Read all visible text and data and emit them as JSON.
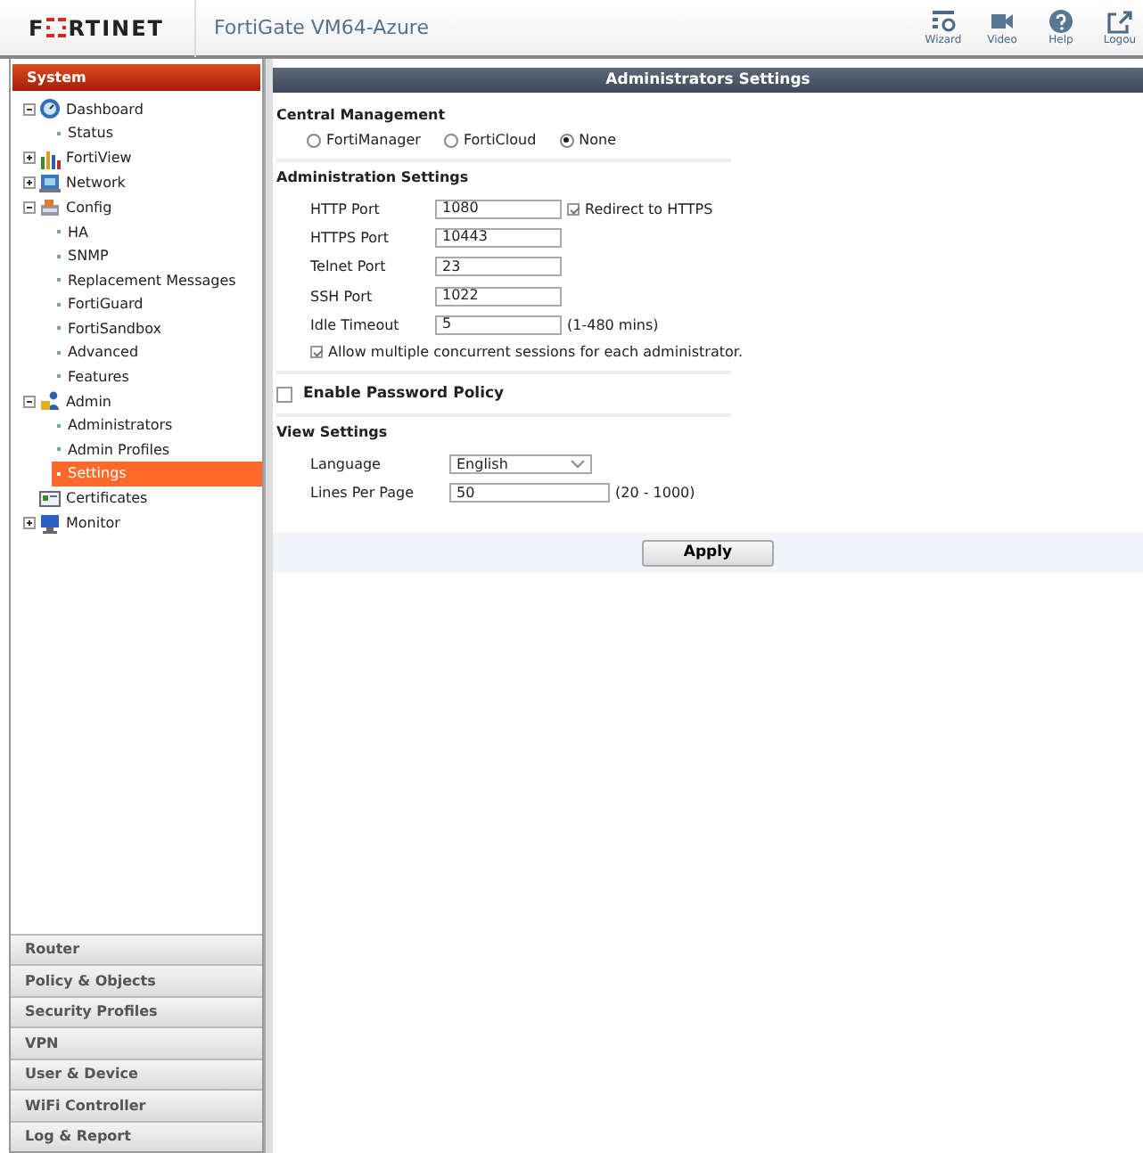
{
  "header": {
    "logo_left": "F",
    "logo_right": "RTINET",
    "product": "FortiGate VM64-Azure",
    "tools": [
      {
        "label": "Wizard"
      },
      {
        "label": "Video"
      },
      {
        "label": "Help"
      },
      {
        "label": "Logou"
      }
    ]
  },
  "sidebar": {
    "title": "System",
    "tree": [
      {
        "label": "Dashboard",
        "kind": "group",
        "expanded": true,
        "selected": false,
        "children": [
          {
            "label": "Status",
            "selected": false
          }
        ]
      },
      {
        "label": "FortiView",
        "kind": "group",
        "expanded": false,
        "selected": false
      },
      {
        "label": "Network",
        "kind": "group",
        "expanded": false,
        "selected": false
      },
      {
        "label": "Config",
        "kind": "group",
        "expanded": true,
        "selected": false,
        "children": [
          {
            "label": "HA",
            "selected": false
          },
          {
            "label": "SNMP",
            "selected": false
          },
          {
            "label": "Replacement Messages",
            "selected": false
          },
          {
            "label": "FortiGuard",
            "selected": false
          },
          {
            "label": "FortiSandbox",
            "selected": false
          },
          {
            "label": "Advanced",
            "selected": false
          },
          {
            "label": "Features",
            "selected": false
          }
        ]
      },
      {
        "label": "Admin",
        "kind": "group",
        "expanded": true,
        "selected": false,
        "children": [
          {
            "label": "Administrators",
            "selected": false
          },
          {
            "label": "Admin Profiles",
            "selected": false
          },
          {
            "label": "Settings",
            "selected": true
          }
        ]
      },
      {
        "label": "Certificates",
        "kind": "page",
        "selected": false
      },
      {
        "label": "Monitor",
        "kind": "group",
        "expanded": false,
        "selected": false
      }
    ],
    "sections": [
      "Router",
      "Policy & Objects",
      "Security Profiles",
      "VPN",
      "User & Device",
      "WiFi Controller",
      "Log & Report"
    ]
  },
  "panel": {
    "title": "Administrators Settings",
    "central_management": {
      "heading": "Central Management",
      "options": [
        {
          "label": "FortiManager",
          "selected": false
        },
        {
          "label": "FortiCloud",
          "selected": false
        },
        {
          "label": "None",
          "selected": true
        }
      ]
    },
    "administration": {
      "heading": "Administration Settings",
      "fields": [
        {
          "label": "HTTP Port",
          "value": "1080",
          "option": {
            "label": "Redirect to HTTPS",
            "checked": true
          }
        },
        {
          "label": "HTTPS Port",
          "value": "10443"
        },
        {
          "label": "Telnet Port",
          "value": "23"
        },
        {
          "label": "SSH Port",
          "value": "1022"
        },
        {
          "label": "Idle Timeout",
          "value": "5",
          "hint": "(1-480 mins)"
        }
      ],
      "concurrent": {
        "label": "Allow multiple concurrent sessions for each administrator.",
        "checked": true
      }
    },
    "password_policy": {
      "label": "Enable Password Policy",
      "checked": false
    },
    "view": {
      "heading": "View Settings",
      "language": {
        "label": "Language",
        "value": "English"
      },
      "lines_per_page": {
        "label": "Lines Per Page",
        "value": "50",
        "hint": "(20 - 1000)"
      }
    },
    "apply": "Apply"
  }
}
